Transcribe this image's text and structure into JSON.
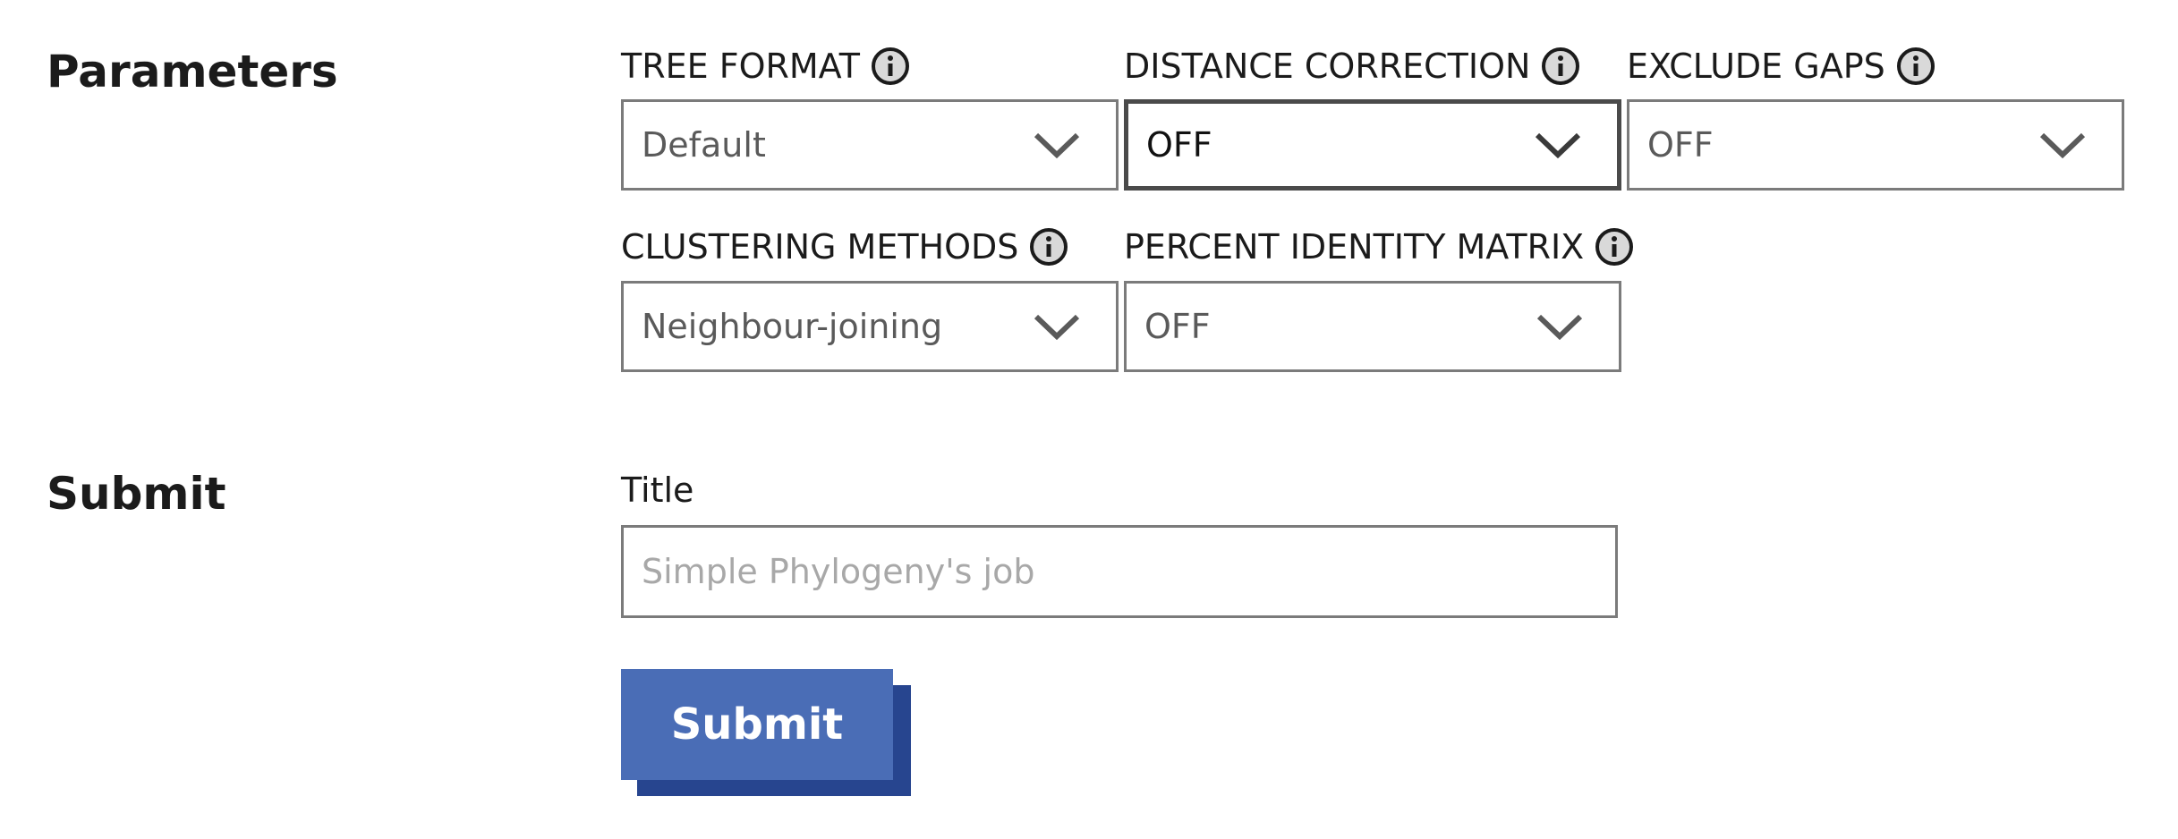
{
  "parameters": {
    "heading": "Parameters",
    "fields": [
      {
        "label": "TREE FORMAT",
        "value": "Default",
        "info_icon": "info-icon"
      },
      {
        "label": "DISTANCE CORRECTION",
        "value": "OFF",
        "info_icon": "info-icon",
        "focused": true
      },
      {
        "label": "EXCLUDE GAPS",
        "value": "OFF",
        "info_icon": "info-icon"
      },
      {
        "label": "CLUSTERING METHODS",
        "value": "Neighbour-joining",
        "info_icon": "info-icon"
      },
      {
        "label": "PERCENT IDENTITY MATRIX",
        "value": "OFF",
        "info_icon": "info-icon"
      }
    ]
  },
  "submit_section": {
    "heading": "Submit",
    "title_label": "Title",
    "title_placeholder": "Simple Phylogeny's job",
    "title_value": "",
    "button_label": "Submit"
  },
  "colors": {
    "button": "#4a6db6",
    "button_shadow": "#27458f",
    "border": "#7b7b7b",
    "focus_border": "#4a4a4a"
  }
}
